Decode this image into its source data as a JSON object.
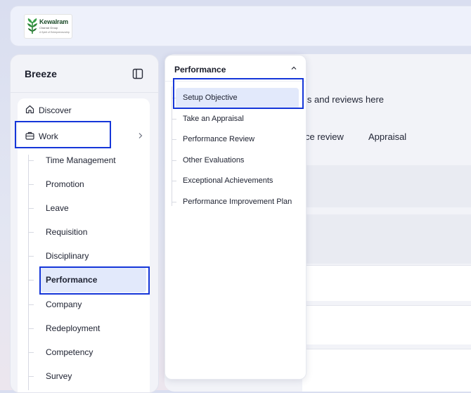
{
  "logo": {
    "name": "Kewalram",
    "subtitle": "Chanrai Group",
    "tagline": "A Spirit of Entrepreneurship"
  },
  "sidebar": {
    "brand": "Breeze",
    "discover_label": "Discover",
    "work_label": "Work",
    "work_items": [
      "Time Management",
      "Promotion",
      "Leave",
      "Requisition",
      "Disciplinary",
      "Performance",
      "Company",
      "Redeployment",
      "Competency",
      "Survey"
    ],
    "active_item": "Performance"
  },
  "dropdown": {
    "title": "Performance",
    "items": [
      "Setup Objective",
      "Take an Appraisal",
      "Performance Review",
      "Other Evaluations",
      "Exceptional Achievements",
      "Performance Improvement Plan"
    ],
    "selected_item": "Setup Objective"
  },
  "main": {
    "description_fragment": "ls and reviews here",
    "tabs": [
      "ce review",
      "Appraisal"
    ]
  },
  "colors": {
    "highlight_border": "#1536d9",
    "selected_bg": "#e2e9fb",
    "logo_green": "#1d4c2a"
  }
}
